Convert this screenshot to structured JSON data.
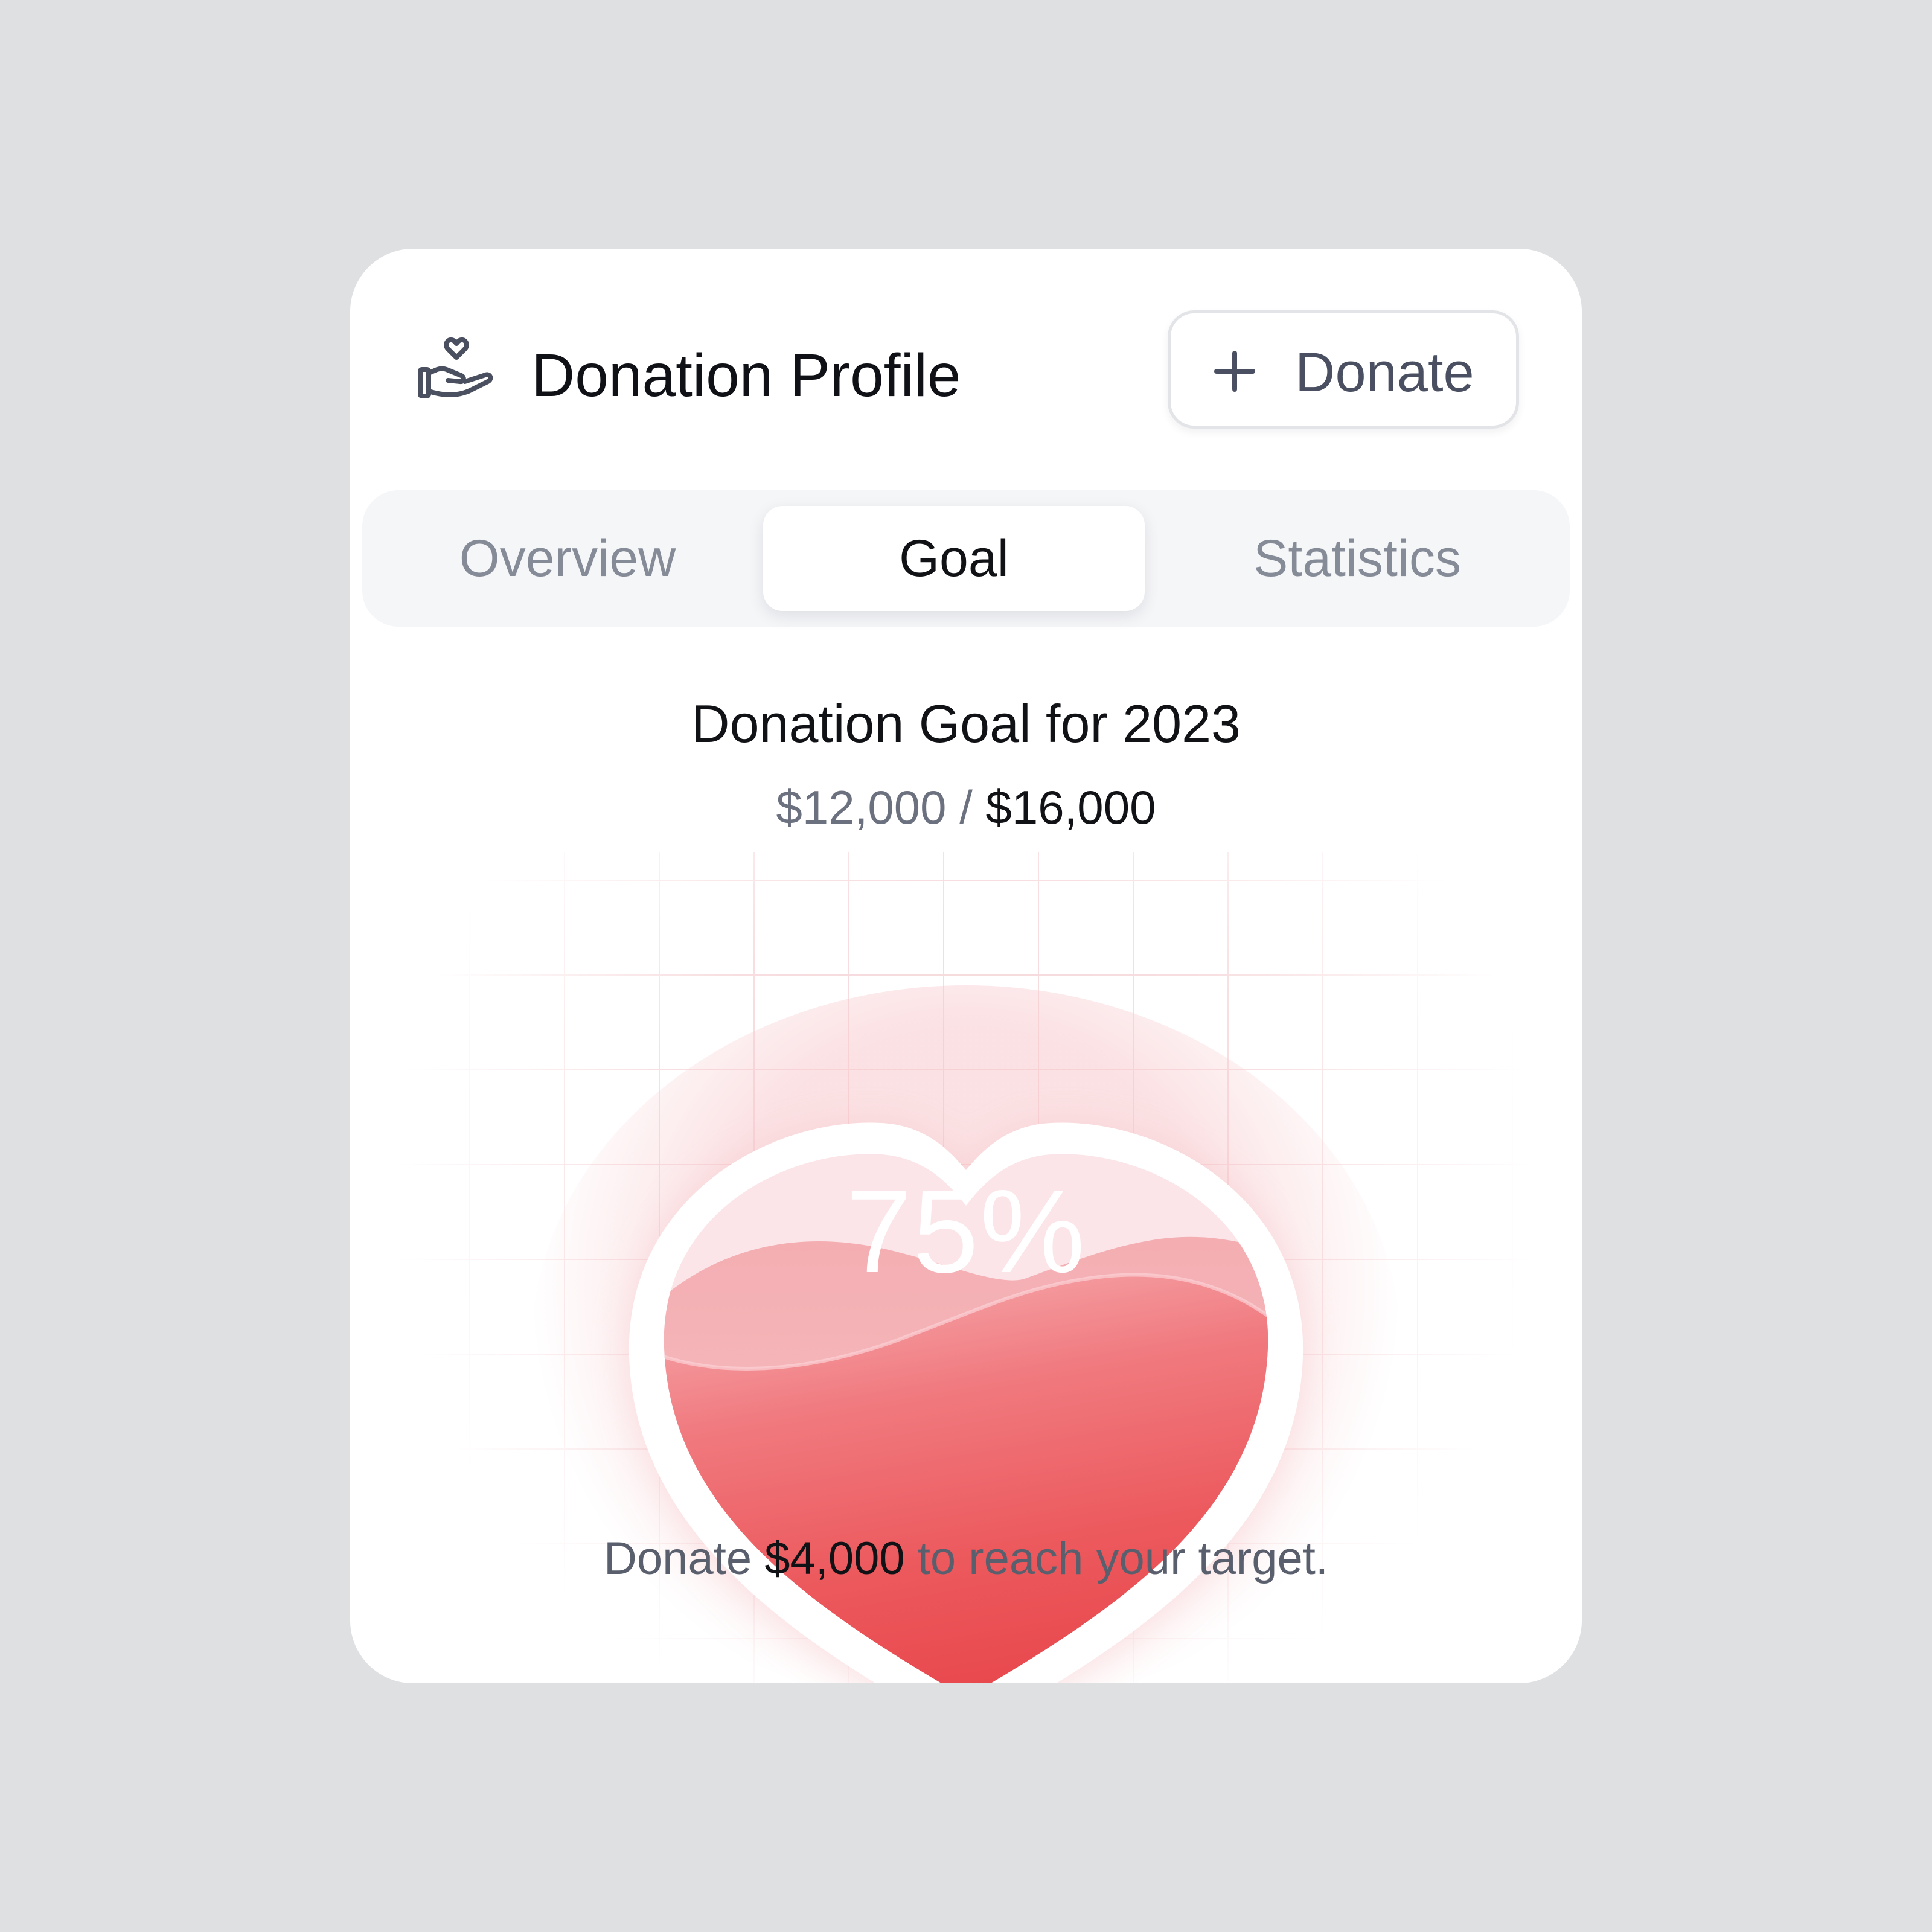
{
  "header": {
    "title": "Donation Profile",
    "icon": "hand-heart-icon",
    "donate_button": {
      "icon": "plus-icon",
      "label": "Donate"
    }
  },
  "tabs": [
    {
      "label": "Overview",
      "active": false
    },
    {
      "label": "Goal",
      "active": true
    },
    {
      "label": "Statistics",
      "active": false
    }
  ],
  "goal": {
    "title": "Donation Goal for 2023",
    "raised": "$12,000",
    "separator": "/",
    "target": "$16,000",
    "percent_label": "75%",
    "progress_fraction": 0.75
  },
  "footer": {
    "prefix": "Donate",
    "amount": "$4,000",
    "suffix": "to reach your target."
  },
  "colors": {
    "accent": "#ec5458",
    "accent_light": "#fbe7ea",
    "background": "#dfe0e2",
    "card": "#ffffff",
    "tab_bar": "#f5f6f8"
  }
}
